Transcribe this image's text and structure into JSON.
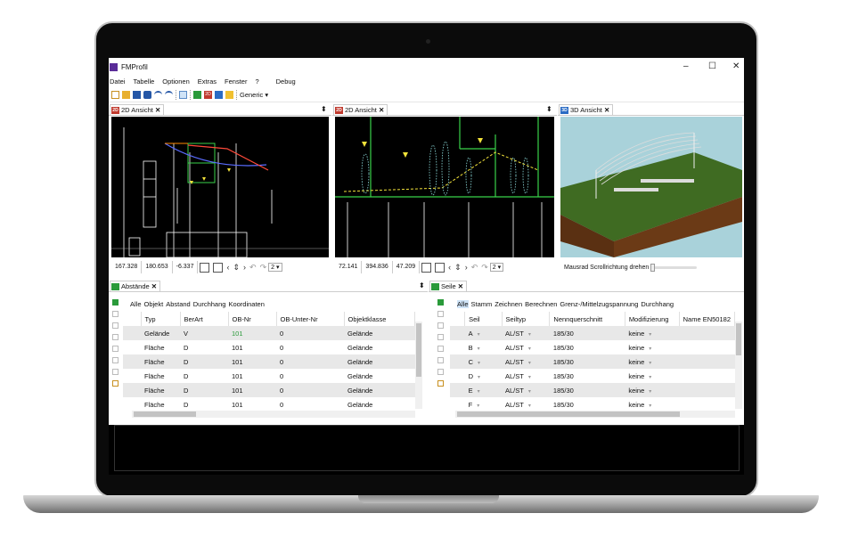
{
  "window": {
    "title": "FMProfil",
    "minimize": "–",
    "maximize": "☐",
    "close": "✕"
  },
  "menu": [
    "Datei",
    "Tabelle",
    "Optionen",
    "Extras",
    "Fenster",
    "?",
    "Debug"
  ],
  "toolbar": {
    "profile": "Generic",
    "dropdown_arrow": "▾"
  },
  "views": [
    {
      "tab": "2D Ansicht",
      "icon": "2D",
      "values": [
        "167.328",
        "180.653",
        "-6.337"
      ],
      "zoom": "2"
    },
    {
      "tab": "2D Ansicht",
      "icon": "2D",
      "values": [
        "72.141",
        "394.836",
        "47.209"
      ],
      "zoom": "2"
    },
    {
      "tab": "3D Ansicht",
      "icon": "3D",
      "status": "Mausrad Scrollrichtung drehen"
    }
  ],
  "abstaende": {
    "tab": "Abstände",
    "filters": [
      "Alle",
      "Objekt",
      "Abstand",
      "Durchhang",
      "Koordinaten"
    ],
    "columns": [
      "Typ",
      "BerArt",
      "OB-Nr",
      "OB-Unter-Nr",
      "Objektklasse"
    ],
    "rows": [
      [
        "Gelände",
        "V",
        "101",
        "0",
        "Gelände"
      ],
      [
        "Fläche",
        "D",
        "101",
        "0",
        "Gelände"
      ],
      [
        "Fläche",
        "D",
        "101",
        "0",
        "Gelände"
      ],
      [
        "Fläche",
        "D",
        "101",
        "0",
        "Gelände"
      ],
      [
        "Fläche",
        "D",
        "101",
        "0",
        "Gelände"
      ],
      [
        "Fläche",
        "D",
        "101",
        "0",
        "Gelände"
      ]
    ]
  },
  "seile": {
    "tab": "Seile",
    "filters": [
      "Alle",
      "Stamm",
      "Zeichnen",
      "Berechnen",
      "Grenz-/Mittelzugspannung",
      "Durchhang"
    ],
    "columns": [
      "Seil",
      "Seiltyp",
      "Nennquerschnitt",
      "Modifizierung",
      "Name EN50182"
    ],
    "rows": [
      [
        "A",
        "AL/ST",
        "185/30",
        "keine"
      ],
      [
        "B",
        "AL/ST",
        "185/30",
        "keine"
      ],
      [
        "C",
        "AL/ST",
        "185/30",
        "keine"
      ],
      [
        "D",
        "AL/ST",
        "185/30",
        "keine"
      ],
      [
        "E",
        "AL/ST",
        "185/30",
        "keine"
      ],
      [
        "F",
        "AL/ST",
        "185/30",
        "keine"
      ]
    ]
  },
  "colors": {
    "accent": "#1e6fd9",
    "grid_alt": "#e8e8e8",
    "terrain_green": "#3f6b22",
    "terrain_soil": "#6b3a16",
    "sky": "#a9d2da"
  }
}
